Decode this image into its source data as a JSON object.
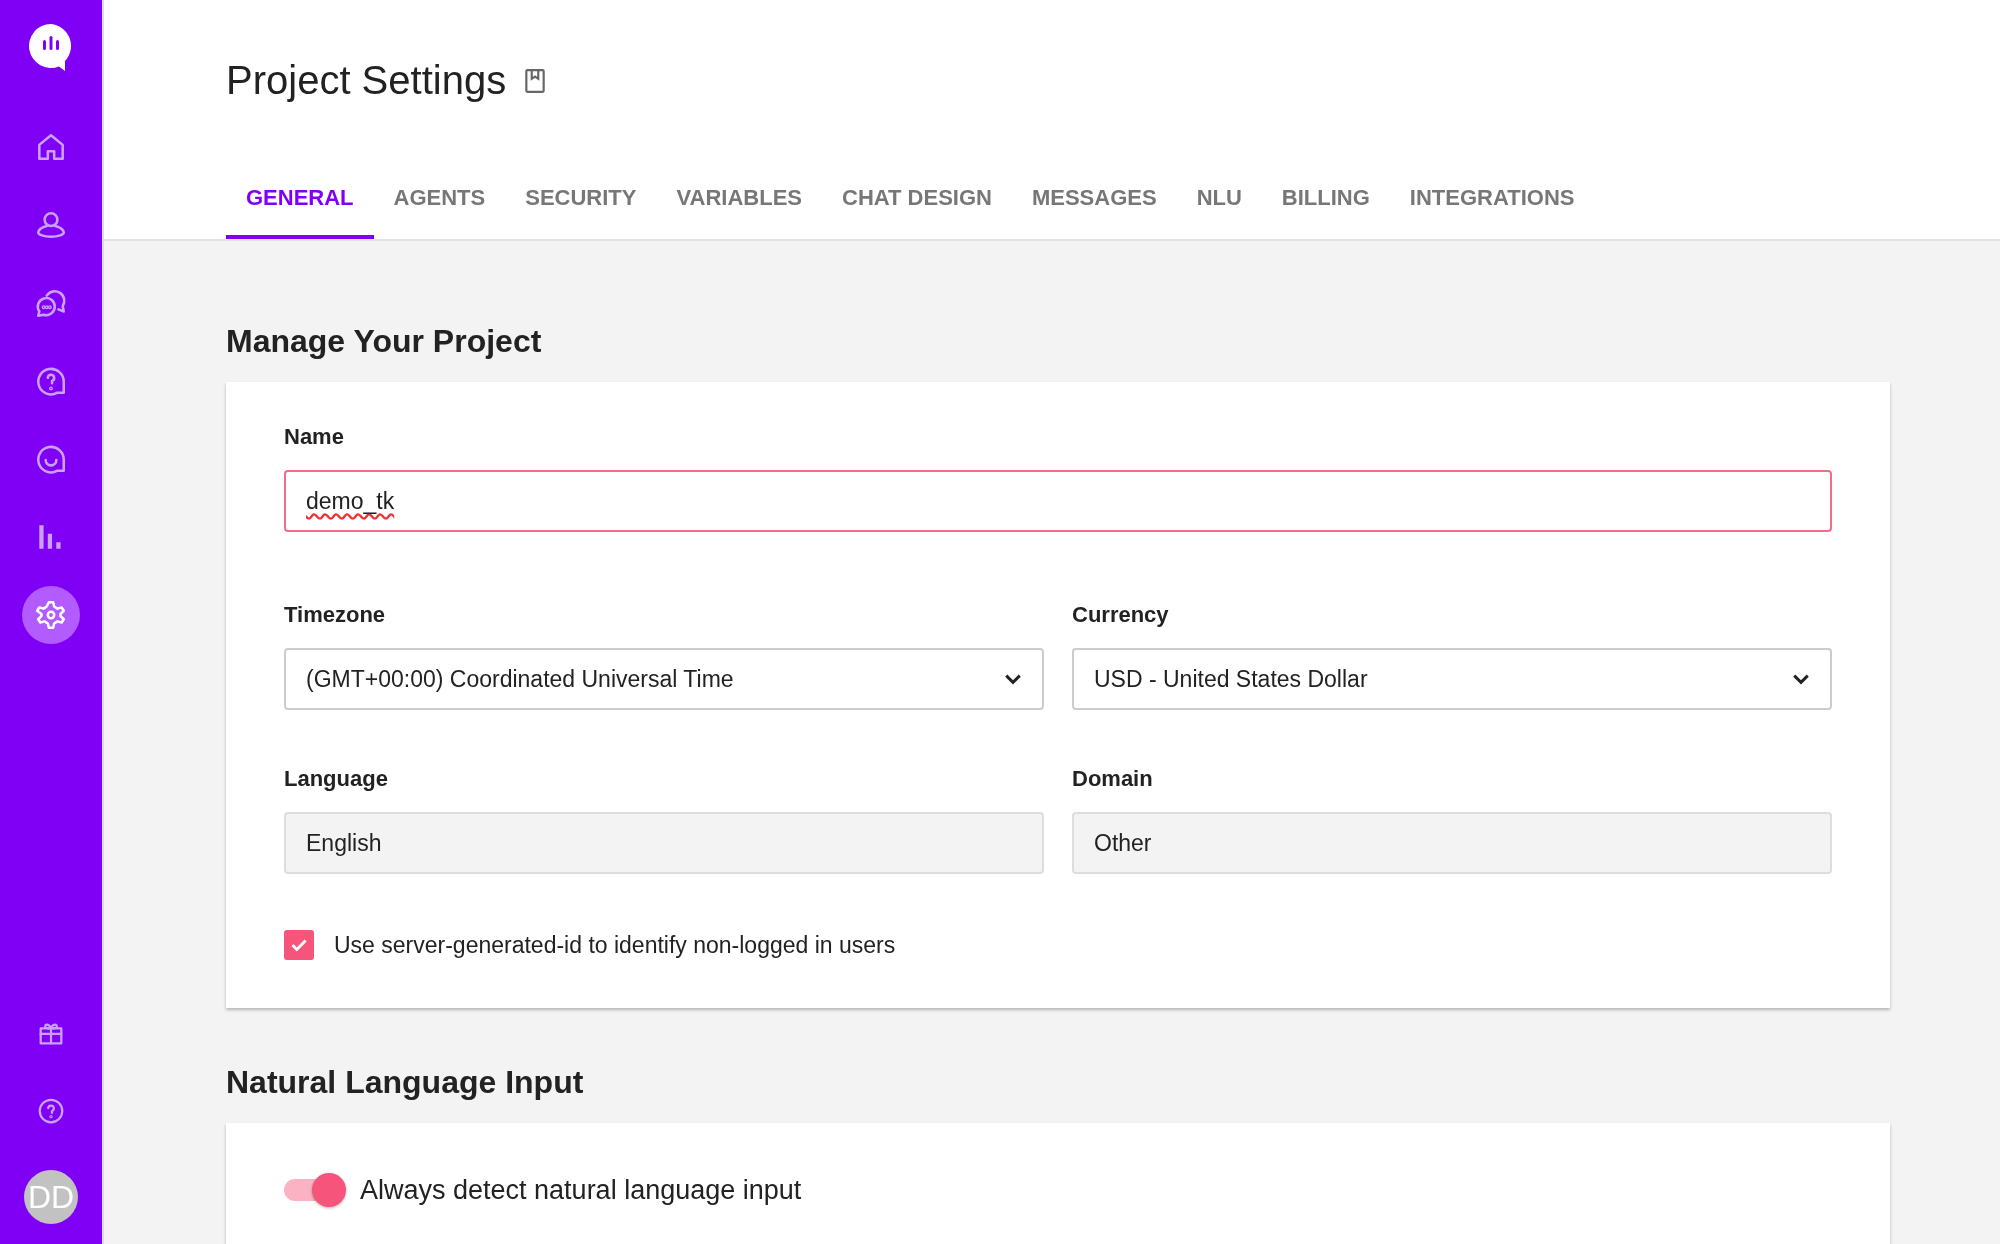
{
  "sidebar": {
    "items": [
      {
        "kind": "home",
        "selected": false
      },
      {
        "kind": "user",
        "selected": false
      },
      {
        "kind": "chats",
        "selected": false
      },
      {
        "kind": "question",
        "selected": false
      },
      {
        "kind": "smile",
        "selected": false
      },
      {
        "kind": "bars",
        "selected": false
      },
      {
        "kind": "gear",
        "selected": true
      }
    ],
    "bottom_items": [
      {
        "kind": "gift"
      },
      {
        "kind": "help"
      }
    ],
    "avatar": "DD"
  },
  "page": {
    "title": "Project Settings"
  },
  "tabs": [
    {
      "label": "GENERAL",
      "selected": true
    },
    {
      "label": "AGENTS",
      "selected": false
    },
    {
      "label": "SECURITY",
      "selected": false
    },
    {
      "label": "VARIABLES",
      "selected": false
    },
    {
      "label": "CHAT DESIGN",
      "selected": false
    },
    {
      "label": "MESSAGES",
      "selected": false
    },
    {
      "label": "NLU",
      "selected": false
    },
    {
      "label": "BILLING",
      "selected": false
    },
    {
      "label": "INTEGRATIONS",
      "selected": false
    }
  ],
  "manage_project": {
    "heading": "Manage Your Project",
    "name": {
      "label": "Name",
      "value": "demo_tk",
      "focused": true
    },
    "fields": [
      {
        "label": "Timezone",
        "value": "(GMT+00:00) Coordinated Universal Time",
        "kind": "select",
        "disabled": false
      },
      {
        "label": "Currency",
        "value": "USD - United States Dollar",
        "kind": "select",
        "disabled": false
      },
      {
        "label": "Language",
        "value": "English",
        "kind": "text",
        "disabled": true
      },
      {
        "label": "Domain",
        "value": "Other",
        "kind": "text",
        "disabled": true
      }
    ],
    "checkbox": {
      "label": "Use server-generated-id to identify non-logged in users",
      "checked": true
    }
  },
  "natural_language_input": {
    "heading": "Natural Language Input",
    "toggle": {
      "label": "Always detect natural language input",
      "on": true
    }
  }
}
